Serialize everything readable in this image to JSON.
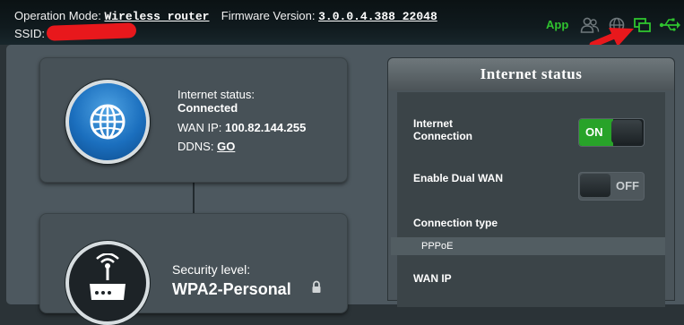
{
  "header": {
    "operation_mode_label": "Operation Mode:",
    "operation_mode_value": "Wireless router",
    "firmware_label": "Firmware Version:",
    "firmware_value": "3.0.0.4.388_22048",
    "ssid_label": "SSID:",
    "app_label": "App",
    "icons": [
      "users-icon",
      "globe-icon",
      "network-map-icon",
      "usb-icon"
    ],
    "colors": {
      "active_icon": "#2fc32f",
      "inactive_icon": "#6f787c",
      "annotation": "#e8181c"
    }
  },
  "internet_card": {
    "status_label": "Internet status:",
    "status_value": "Connected",
    "wan_ip_label": "WAN IP:",
    "wan_ip_value": "100.82.144.255",
    "ddns_label": "DDNS:",
    "ddns_link": "GO"
  },
  "wireless_card": {
    "security_label": "Security level:",
    "security_value": "WPA2-Personal"
  },
  "status_panel": {
    "title": "Internet status",
    "internet_connection_label": "Internet Connection",
    "internet_connection_toggle": "ON",
    "dual_wan_label": "Enable Dual WAN",
    "dual_wan_toggle": "OFF",
    "connection_type_label": "Connection type",
    "connection_type_value": "PPPoE",
    "wan_ip_label": "WAN IP"
  }
}
